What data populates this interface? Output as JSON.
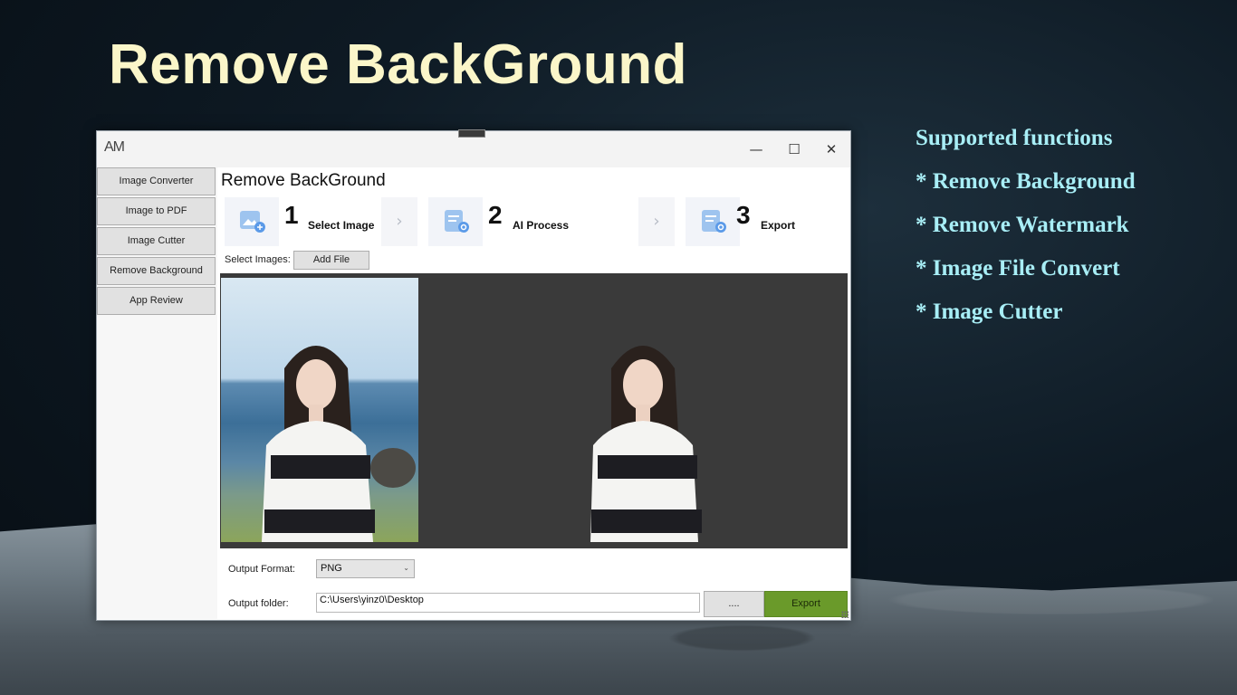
{
  "slide": {
    "title": "Remove BackGround",
    "features": [
      "Supported functions",
      "* Remove Background",
      "* Remove Watermark",
      "* Image File Convert",
      "* Image Cutter"
    ]
  },
  "app": {
    "logo": "AM",
    "controls": {
      "minimize": "—",
      "maximize": "☐",
      "close": "✕"
    },
    "sidebar": [
      "Image Converter",
      "Image to PDF",
      "Image Cutter",
      "Remove Background",
      "App Review"
    ],
    "page_title": "Remove BackGround",
    "steps": [
      {
        "num": "1",
        "label": "Select Image"
      },
      {
        "num": "2",
        "label": "AI Process"
      },
      {
        "num": "3",
        "label": "Export"
      }
    ],
    "select_images_label": "Select Images:",
    "add_file_label": "Add File",
    "output_format_label": "Output Format:",
    "output_format_value": "PNG",
    "output_folder_label": "Output folder:",
    "output_folder_value": "C:\\Users\\yinz0\\Desktop",
    "browse_label": "....",
    "export_label": "Export",
    "colors": {
      "export": "#6a9a2a",
      "canvas": "#3a3a3a",
      "title": "#fbf6c9",
      "features": "#a8eef6"
    }
  }
}
